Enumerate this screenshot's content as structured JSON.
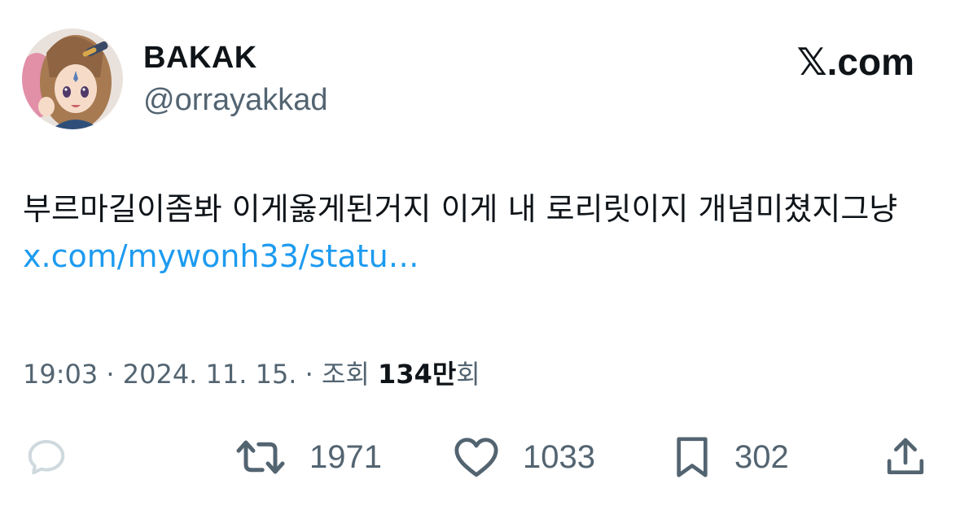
{
  "user": {
    "display_name": "BAKAK",
    "handle": "@orrayakkad"
  },
  "brand": {
    "logo_text": "𝕏",
    "logo_suffix": ".com"
  },
  "tweet": {
    "text": "부르마길이좀봐 이게옳게된거지 이게 내 로리릿이지 개념미쳤지그냥",
    "link_text": "x.com/mywonh33/statu…"
  },
  "meta": {
    "time": "19:03",
    "separator": "·",
    "date": "2024. 11. 15.",
    "views_label": "조회",
    "views_count": "134만",
    "views_suffix": "회"
  },
  "actions": {
    "reply": {
      "icon": "reply-icon"
    },
    "retweet": {
      "icon": "retweet-icon",
      "count": "1971"
    },
    "like": {
      "icon": "heart-icon",
      "count": "1033"
    },
    "bookmark": {
      "icon": "bookmark-icon",
      "count": "302"
    },
    "share": {
      "icon": "share-icon"
    }
  },
  "colors": {
    "text_primary": "#0f1419",
    "text_secondary": "#536471",
    "link": "#1d9bf0",
    "reply_icon": "#cfd9de"
  }
}
